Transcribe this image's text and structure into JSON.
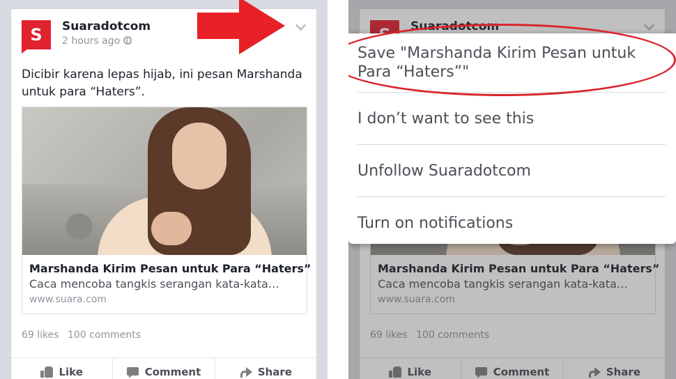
{
  "post": {
    "page_name": "Suaradotcom",
    "logo_letter": "S",
    "time": "2 hours ago",
    "text": "Dicibir karena lepas hijab, ini pesan Marshanda untuk para “Haters”.",
    "link": {
      "title": "Marshanda Kirim Pesan untuk Para “Haters”",
      "description": "Caca mencoba tangkis serangan kata-kata…",
      "domain": "www.suara.com"
    },
    "stats": {
      "likes": "69 likes",
      "comments": "100 comments"
    },
    "actions": {
      "like": "Like",
      "comment": "Comment",
      "share": "Share"
    }
  },
  "menu": {
    "items": [
      "Save \"Marshanda Kirim Pesan untuk Para “Haters”\"",
      "I don’t want to see this",
      "Unfollow Suaradotcom",
      "Turn on notifications"
    ]
  },
  "colors": {
    "brand": "#e0212e",
    "annotation": "#e82027",
    "text": "#1d2129",
    "muted": "#90949c"
  },
  "icons": [
    "globe-icon",
    "chevron-down-icon",
    "like-icon",
    "comment-icon",
    "share-icon",
    "red-arrow",
    "highlight-ellipse"
  ]
}
